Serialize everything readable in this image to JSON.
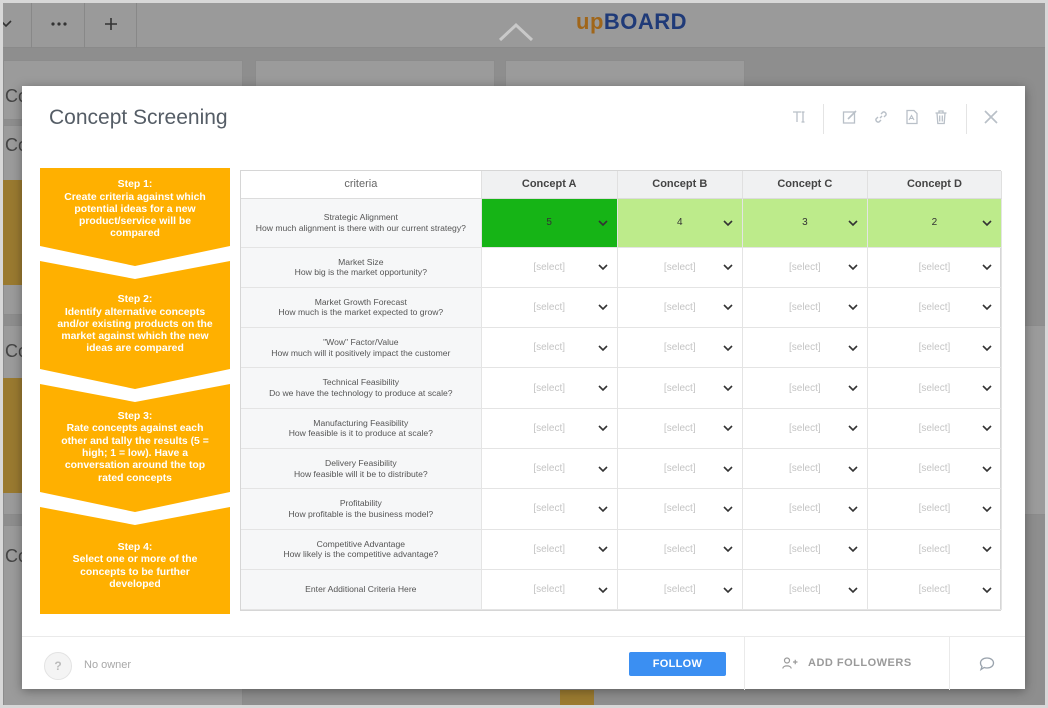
{
  "app": {
    "logo_up": "up",
    "logo_board": "BOARD",
    "bg_fragments": [
      "Co",
      "Co",
      "Co",
      "Co",
      "Co"
    ]
  },
  "modal": {
    "title": "Concept Screening",
    "toolbar_icons": [
      "text-format-icon",
      "edit-icon",
      "link-icon",
      "pdf-icon",
      "trash-icon",
      "close-icon"
    ]
  },
  "steps": [
    {
      "text": "Step 1:\nCreate criteria against which potential ideas for a new product/service will be compared"
    },
    {
      "text": "Step 2:\nIdentify alternative concepts and/or existing products on the market against which the new ideas are compared"
    },
    {
      "text": "Step 3:\nRate concepts against each other and tally the results (5 = high; 1 = low). Have a conversation around the top rated concepts"
    },
    {
      "text": "Step 4:\nSelect one or more of the concepts to be further developed"
    }
  ],
  "table": {
    "criteria_header": "criteria",
    "concepts": [
      "Concept A",
      "Concept B",
      "Concept C",
      "Concept D"
    ],
    "placeholder": "[select]",
    "rows": [
      {
        "name": "Strategic Alignment",
        "question": "How much alignment is there with our current strategy?",
        "values": [
          "5",
          "4",
          "3",
          "2"
        ]
      },
      {
        "name": "Market Size",
        "question": "How big is the market opportunity?",
        "values": [
          "",
          "",
          "",
          ""
        ]
      },
      {
        "name": "Market Growth Forecast",
        "question": "How much is the market expected to grow?",
        "values": [
          "",
          "",
          "",
          ""
        ]
      },
      {
        "name": "\"Wow\" Factor/Value",
        "question": "How much will it positively impact the customer",
        "values": [
          "",
          "",
          "",
          ""
        ]
      },
      {
        "name": "Technical Feasibility",
        "question": "Do we have the technology to produce at scale?",
        "values": [
          "",
          "",
          "",
          ""
        ]
      },
      {
        "name": "Manufacturing Feasibility",
        "question": "How feasible is it to produce at scale?",
        "values": [
          "",
          "",
          "",
          ""
        ]
      },
      {
        "name": "Delivery Feasibility",
        "question": "How feasible will it be to distribute?",
        "values": [
          "",
          "",
          "",
          ""
        ]
      },
      {
        "name": "Profitability",
        "question": "How profitable is the business model?",
        "values": [
          "",
          "",
          "",
          ""
        ]
      },
      {
        "name": "Competitive Advantage",
        "question": "How likely is the competitive advantage?",
        "values": [
          "",
          "",
          "",
          ""
        ]
      },
      {
        "name": "Enter Additional Criteria Here",
        "question": "",
        "values": [
          "",
          "",
          "",
          ""
        ]
      }
    ],
    "colors": {
      "score_5": "#16b416",
      "score_low": "#bdeb8b"
    }
  },
  "footer": {
    "owner_avatar": "?",
    "owner_text": "No owner",
    "follow_label": "FOLLOW",
    "add_followers_label": "ADD FOLLOWERS"
  }
}
